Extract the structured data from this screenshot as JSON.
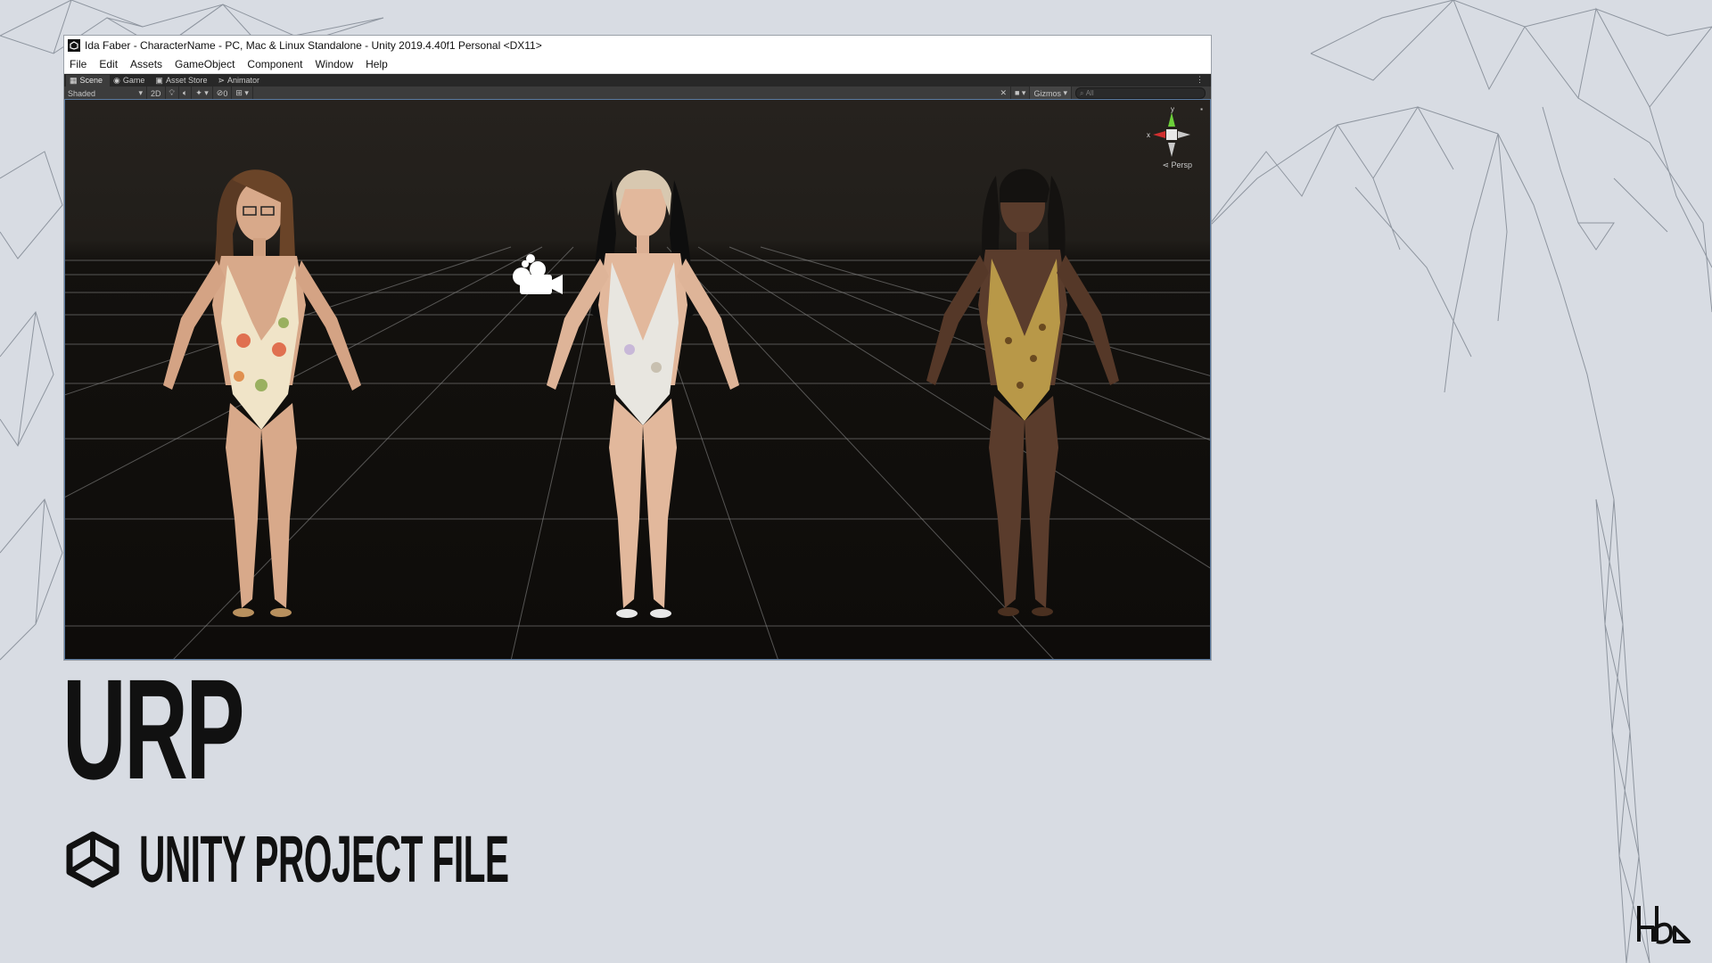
{
  "window": {
    "title": "Ida Faber - CharacterName - PC, Mac & Linux Standalone - Unity 2019.4.40f1 Personal <DX11>"
  },
  "menu": {
    "items": [
      "File",
      "Edit",
      "Assets",
      "GameObject",
      "Component",
      "Window",
      "Help"
    ]
  },
  "tabs": {
    "items": [
      {
        "label": "Scene",
        "icon": "scene-icon"
      },
      {
        "label": "Game",
        "icon": "gamepad-icon"
      },
      {
        "label": "Asset Store",
        "icon": "store-icon"
      },
      {
        "label": "Animator",
        "icon": "animator-icon"
      }
    ]
  },
  "toolbar": {
    "shading_mode": "Shaded",
    "mode_2d": "2D",
    "hidden_count": "0",
    "gizmos_label": "Gizmos",
    "search_placeholder": "All"
  },
  "scene": {
    "projection_label": "Persp",
    "axis_x": "x",
    "axis_y": "y",
    "background_color": "#0e0c0a",
    "grid_color": "#9a9a9a"
  },
  "caption": {
    "title": "URP",
    "subtitle": "UNITY PROJECT FILE"
  },
  "colors": {
    "page_background": "#d8dce3",
    "caption_text": "#111111",
    "viewport_border": "#5a7aa0"
  }
}
